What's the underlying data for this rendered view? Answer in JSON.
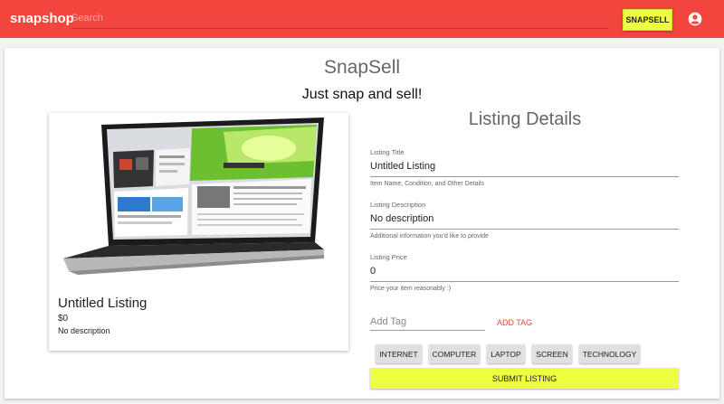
{
  "appbar": {
    "brand": "snapshop",
    "search_placeholder": "Search",
    "snapsell_label": "SNAPSELL",
    "account_icon": "account-circle-icon",
    "color": "#f2453d"
  },
  "header": {
    "title": "SnapSell",
    "tagline": "Just snap and sell!"
  },
  "preview": {
    "image": "laptop-image",
    "title": "Untitled Listing",
    "price": "$0",
    "description": "No description"
  },
  "form": {
    "heading": "Listing Details",
    "title_field": {
      "label": "Listing Title",
      "value": "Untitled Listing",
      "help": "Item Name, Condition, and Other Details"
    },
    "description_field": {
      "label": "Listing Description",
      "value": "No description",
      "help": "Additional information you'd like to provide"
    },
    "price_field": {
      "label": "Listing Price",
      "value": "0",
      "help": "Price your item reasonably :)"
    },
    "tag_placeholder": "Add Tag",
    "add_tag_label": "ADD TAG",
    "tags": [
      "INTERNET",
      "COMPUTER",
      "LAPTOP",
      "SCREEN",
      "TECHNOLOGY"
    ],
    "submit_label": "SUBMIT LISTING",
    "accent": "#eeff41"
  }
}
